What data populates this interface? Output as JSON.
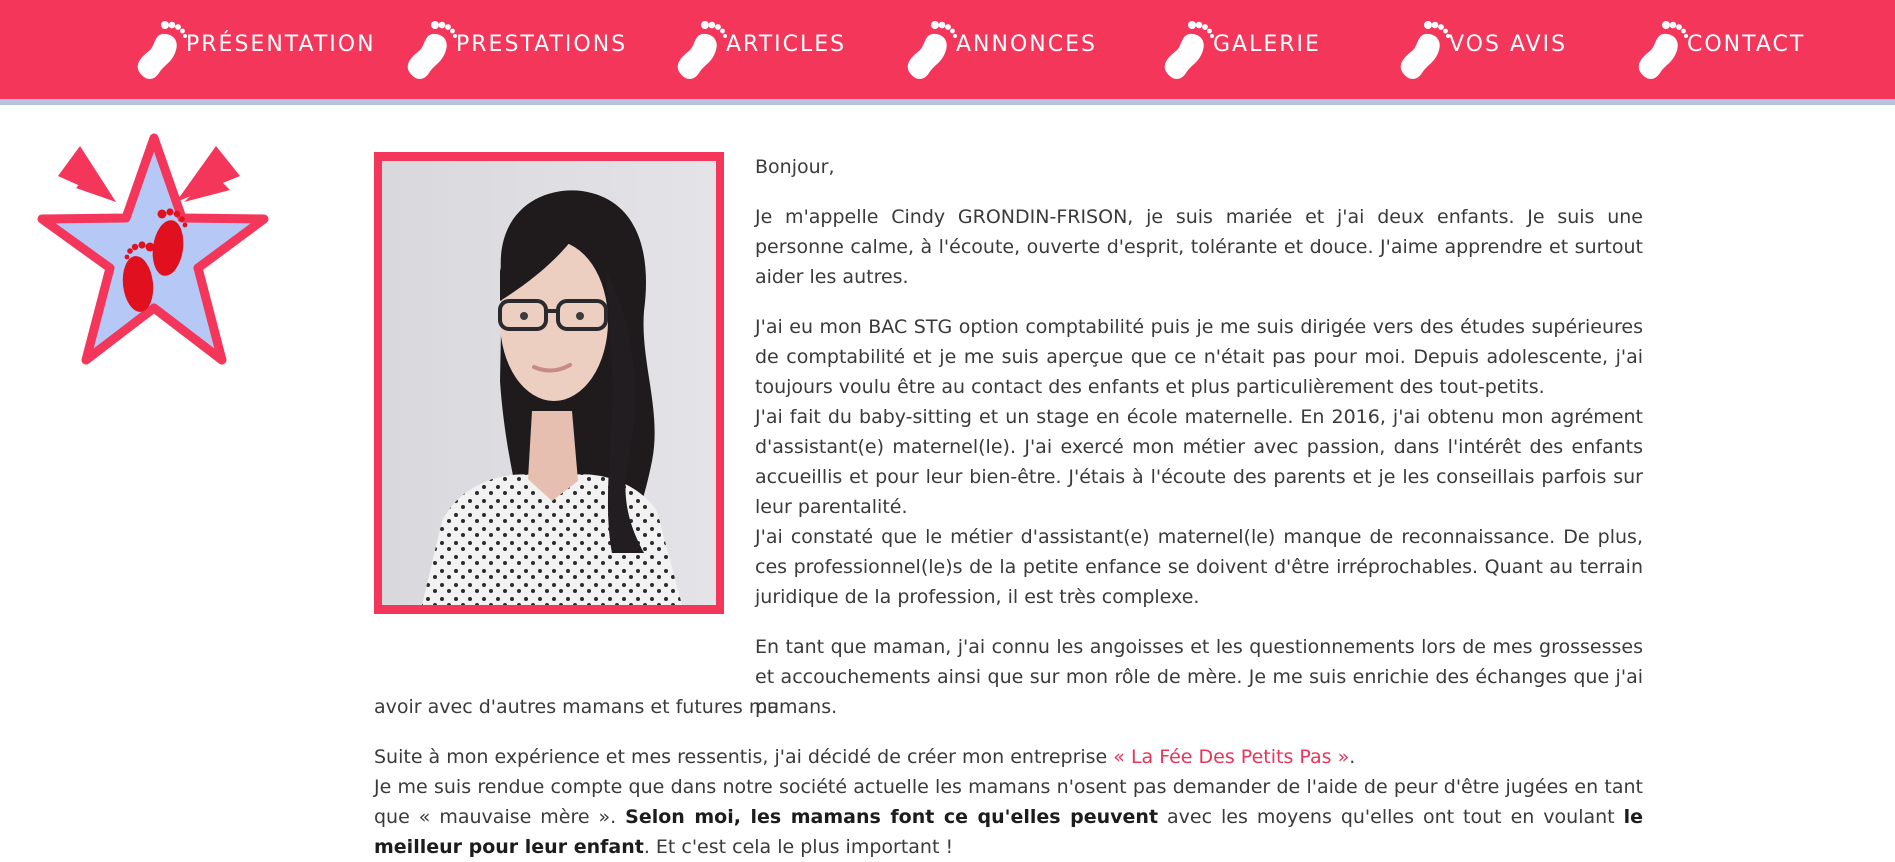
{
  "nav": {
    "items": [
      {
        "label": "PRÉSENTATION"
      },
      {
        "label": "PRESTATIONS"
      },
      {
        "label": "ARTICLES"
      },
      {
        "label": "ANNONCES"
      },
      {
        "label": "GALERIE"
      },
      {
        "label": "VOS AVIS"
      },
      {
        "label": "CONTACT"
      }
    ]
  },
  "colors": {
    "accent": "#f4365a",
    "nav_divider": "#b6c4e4",
    "star_fill": "#b6c8f6",
    "footprint": "#e0101e",
    "text": "#3a3a3a"
  },
  "content": {
    "greeting": "Bonjour,",
    "p1": "Je m'appelle Cindy GRONDIN-FRISON, je suis mariée et j'ai deux enfants. Je suis une personne calme, à l'écoute, ouverte d'esprit, tolérante et douce. J'aime apprendre et surtout aider les autres.",
    "p2": "J'ai eu mon BAC STG option comptabilité puis je me suis dirigée vers des études supérieures de comptabilité et je me suis aperçue que ce n'était pas pour moi. Depuis adolescente, j'ai toujours voulu être au contact des enfants et plus particulièrement des tout-petits.",
    "p3": "J'ai fait du baby-sitting et un stage en école maternelle. En 2016, j'ai obtenu mon agrément d'assistant(e) maternel(le). J'ai exercé mon métier avec passion, dans l'intérêt des enfants accueillis et pour leur bien-être. J'étais à l'écoute des parents et je les conseillais parfois sur leur parentalité.",
    "p4": "J'ai constaté que le métier d'assistant(e) maternel(le) manque de reconnaissance. De plus, ces professionnel(le)s de la petite enfance se doivent d'être irréprochables. Quant au terrain juridique de la profession, il est très complexe.",
    "p5_line1": "En tant que maman, j'ai connu les angoisses et les questionnements lors de mes grossesses et accouchements ainsi que sur mon rôle de mère. Je me suis enrichie des échanges que j'ai pu",
    "p5_line2": "avoir avec d'autres mamans et futures mamans.",
    "p6_prefix": "Suite à mon expérience et mes ressentis, j'ai décidé de créer mon entreprise ",
    "p6_company": "« La Fée Des Petits Pas »",
    "p6_suffix": ".",
    "p7_start": "Je me suis rendue compte que dans notre société actuelle les mamans n'osent pas demander de l'aide de peur d'être jugées en tant que « mauvaise mère ». ",
    "p7_bold1": "Selon moi, les mamans font ce qu'elles peuvent",
    "p7_mid": " avec les moyens qu'elles ont tout en voulant ",
    "p7_bold2": "le meilleur pour leur enfant",
    "p7_end": ". Et c'est cela le plus important !"
  }
}
